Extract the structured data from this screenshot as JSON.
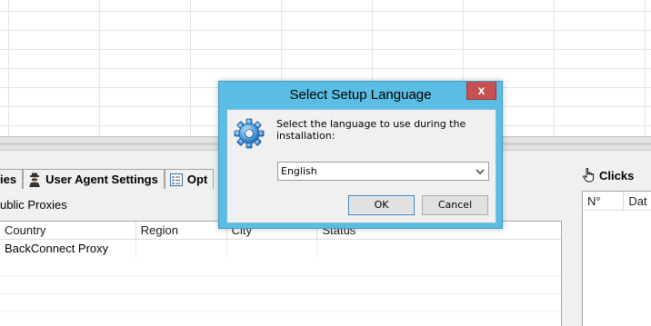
{
  "dialog": {
    "title": "Select Setup Language",
    "close_label": "x",
    "message": "Select the language to use during the installation:",
    "language_selected": "English",
    "ok_label": "OK",
    "cancel_label": "Cancel",
    "icon": "gear-icon"
  },
  "tabs": [
    {
      "label": "ies",
      "icon": ""
    },
    {
      "label": "User Agent Settings",
      "icon": "spy-agent-icon"
    },
    {
      "label": "Opt",
      "icon": "options-checklist-icon"
    }
  ],
  "proxies": {
    "section_label": "ublic Proxies",
    "columns": [
      "Country",
      "Region",
      "City",
      "Status"
    ],
    "rows": [
      [
        "BackConnect Proxy",
        "",
        "",
        ""
      ]
    ]
  },
  "clicks": {
    "title": "Clicks",
    "icon": "hand-pointer-icon",
    "columns": [
      "N°",
      "Dat"
    ]
  },
  "colors": {
    "dialog_frame": "#5bbde4",
    "close_button": "#c75050",
    "panel_bg": "#f0f0f0"
  }
}
